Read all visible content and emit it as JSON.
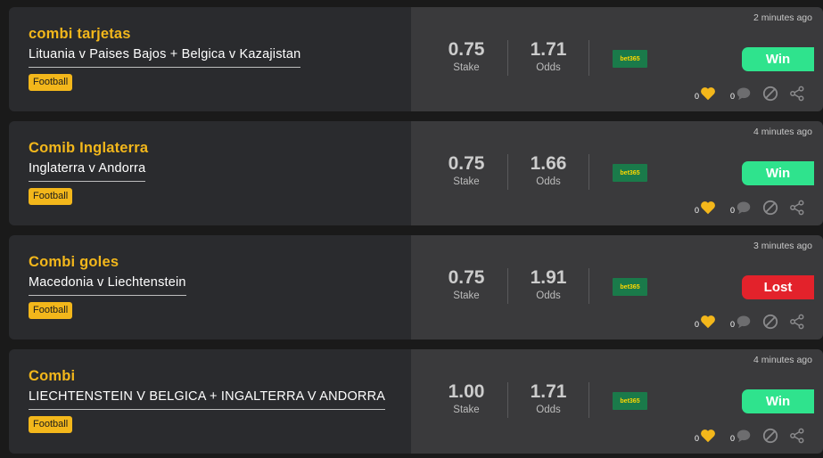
{
  "ui": {
    "stake_label": "Stake",
    "odds_label": "Odds",
    "bookmaker_label": "bet365"
  },
  "tips": [
    {
      "title": "combi tarjetas",
      "match": "Lituania v Paises Bajos + Belgica v Kazajistan",
      "sport": "Football",
      "stake": "0.75",
      "odds": "1.71",
      "time": "2 minutes ago",
      "result": "Win",
      "result_status": "win",
      "likes": "0",
      "comments": "0"
    },
    {
      "title": "Comib Inglaterra",
      "match": "Inglaterra v Andorra",
      "sport": "Football",
      "stake": "0.75",
      "odds": "1.66",
      "time": "4 minutes ago",
      "result": "Win",
      "result_status": "win",
      "likes": "0",
      "comments": "0"
    },
    {
      "title": "Combi goles",
      "match": "Macedonia v Liechtenstein",
      "sport": "Football",
      "stake": "0.75",
      "odds": "1.91",
      "time": "3 minutes ago",
      "result": "Lost",
      "result_status": "lost",
      "likes": "0",
      "comments": "0"
    },
    {
      "title": "Combi",
      "match": "LIECHTENSTEIN V BELGICA + INGALTERRA V ANDORRA",
      "sport": "Football",
      "stake": "1.00",
      "odds": "1.71",
      "time": "4 minutes ago",
      "result": "Win",
      "result_status": "win",
      "likes": "0",
      "comments": "0"
    }
  ],
  "colors": {
    "accent": "#f3b71b",
    "win": "#2fe38d",
    "lost": "#e3222b",
    "bookmaker": "#1a7a4a"
  },
  "icons": {
    "like": "heart-icon",
    "comment": "comment-bubble-icon",
    "block": "block-icon",
    "share": "share-icon"
  }
}
